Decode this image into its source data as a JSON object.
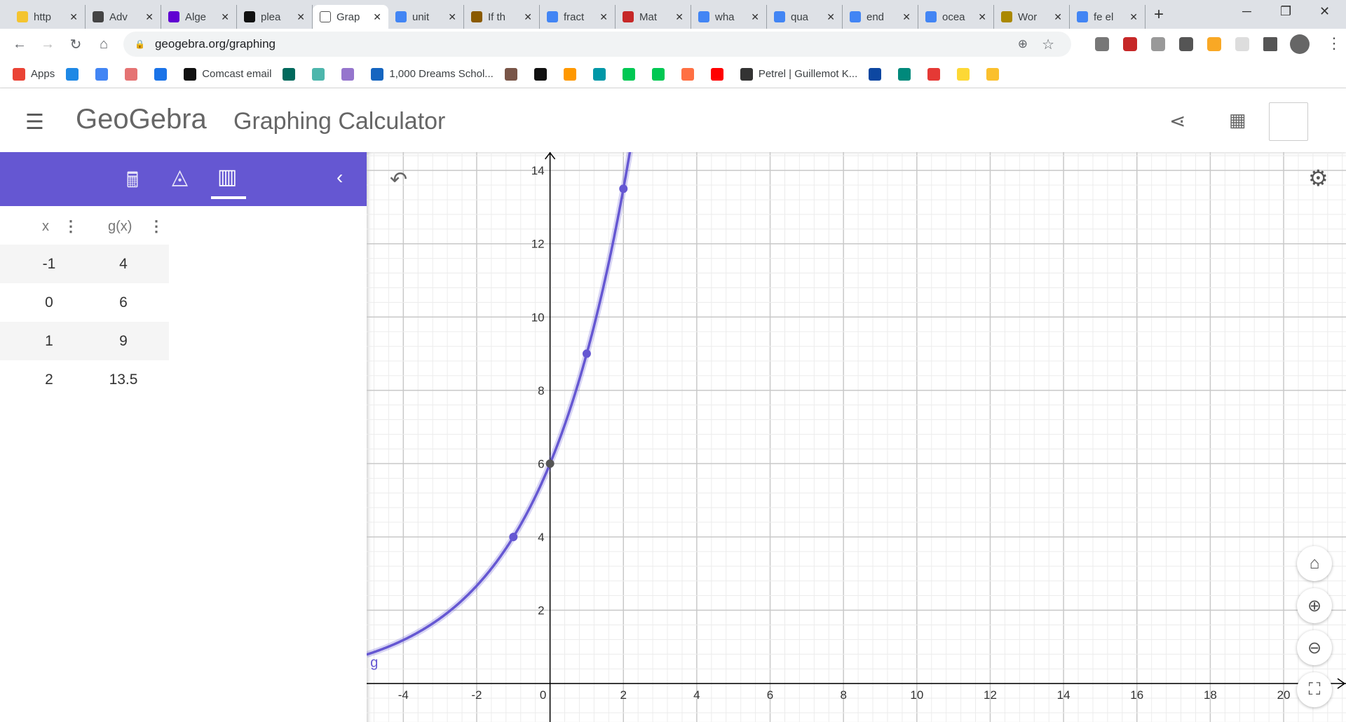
{
  "browser": {
    "tabs": [
      {
        "title": "http",
        "color": "#f4c430",
        "icon": "bulb-icon"
      },
      {
        "title": "Adv",
        "color": "#444",
        "icon": "bee-icon"
      },
      {
        "title": "Alge",
        "color": "#6001d2",
        "icon": "yahoo-icon"
      },
      {
        "title": "plea",
        "color": "#111",
        "icon": "brainly-icon"
      },
      {
        "title": "Grap",
        "color": "#fff",
        "icon": "geogebra-icon",
        "active": true
      },
      {
        "title": "unit",
        "color": "#4285f4",
        "icon": "google-icon"
      },
      {
        "title": "If th",
        "color": "#8a5a00",
        "icon": "tab-icon"
      },
      {
        "title": "fract",
        "color": "#4285f4",
        "icon": "google-icon"
      },
      {
        "title": "Mat",
        "color": "#c62828",
        "icon": "mathway-icon"
      },
      {
        "title": "wha",
        "color": "#4285f4",
        "icon": "google-icon"
      },
      {
        "title": "qua",
        "color": "#4285f4",
        "icon": "google-icon"
      },
      {
        "title": "end",
        "color": "#4285f4",
        "icon": "google-icon"
      },
      {
        "title": "ocea",
        "color": "#4285f4",
        "icon": "google-icon"
      },
      {
        "title": "Wor",
        "color": "#aa8800",
        "icon": "tab-icon"
      },
      {
        "title": "fe el",
        "color": "#4285f4",
        "icon": "google-icon"
      }
    ],
    "close_glyph": "✕",
    "new_tab": "+",
    "url": "geogebra.org/graphing",
    "bookmarks": [
      {
        "label": "Apps",
        "color": "#ea4335"
      },
      {
        "label": "",
        "color": "#1e88e5"
      },
      {
        "label": "",
        "color": "#4285f4"
      },
      {
        "label": "",
        "color": "#e57373"
      },
      {
        "label": "",
        "color": "#1a73e8"
      },
      {
        "label": "Comcast email",
        "color": "#111"
      },
      {
        "label": "",
        "color": "#00695c"
      },
      {
        "label": "",
        "color": "#4db6ac"
      },
      {
        "label": "",
        "color": "#9575cd"
      },
      {
        "label": "1,000 Dreams Schol...",
        "color": "#1565c0"
      },
      {
        "label": "",
        "color": "#795548"
      },
      {
        "label": "",
        "color": "#111"
      },
      {
        "label": "",
        "color": "#ff9800"
      },
      {
        "label": "",
        "color": "#0097a7"
      },
      {
        "label": "",
        "color": "#00c853"
      },
      {
        "label": "",
        "color": "#00c853"
      },
      {
        "label": "",
        "color": "#ff7043"
      },
      {
        "label": "",
        "color": "#ff0000"
      },
      {
        "label": "Petrel | Guillemot K...",
        "color": "#333"
      },
      {
        "label": "",
        "color": "#0d47a1"
      },
      {
        "label": "",
        "color": "#00897b"
      },
      {
        "label": "",
        "color": "#e53935"
      },
      {
        "label": "",
        "color": "#fdd835"
      },
      {
        "label": "",
        "color": "#fbc02d"
      }
    ]
  },
  "app": {
    "logo": "GeoGebra",
    "title": "Graphing Calculator",
    "accent": "#6557d2"
  },
  "table": {
    "headers": [
      "x",
      "g(x)"
    ],
    "rows": [
      [
        "-1",
        "4"
      ],
      [
        "0",
        "6"
      ],
      [
        "1",
        "9"
      ],
      [
        "2",
        "13.5"
      ]
    ]
  },
  "chart_data": {
    "type": "line",
    "function_label": "g",
    "function": "g(x)=6*1.5^x",
    "xlim": [
      -5,
      21.7
    ],
    "ylim": [
      -1.05,
      14.5
    ],
    "x_ticks": [
      -4,
      -2,
      0,
      2,
      4,
      6,
      8,
      10,
      12,
      14,
      16,
      18,
      20
    ],
    "y_ticks": [
      2,
      4,
      6,
      8,
      10,
      12,
      14
    ],
    "grid": true,
    "points": [
      {
        "x": -1,
        "y": 4
      },
      {
        "x": 0,
        "y": 6
      },
      {
        "x": 1,
        "y": 9
      },
      {
        "x": 2,
        "y": 13.5
      }
    ],
    "curve_color": "#6557d2",
    "intercept_color": "#555555"
  }
}
